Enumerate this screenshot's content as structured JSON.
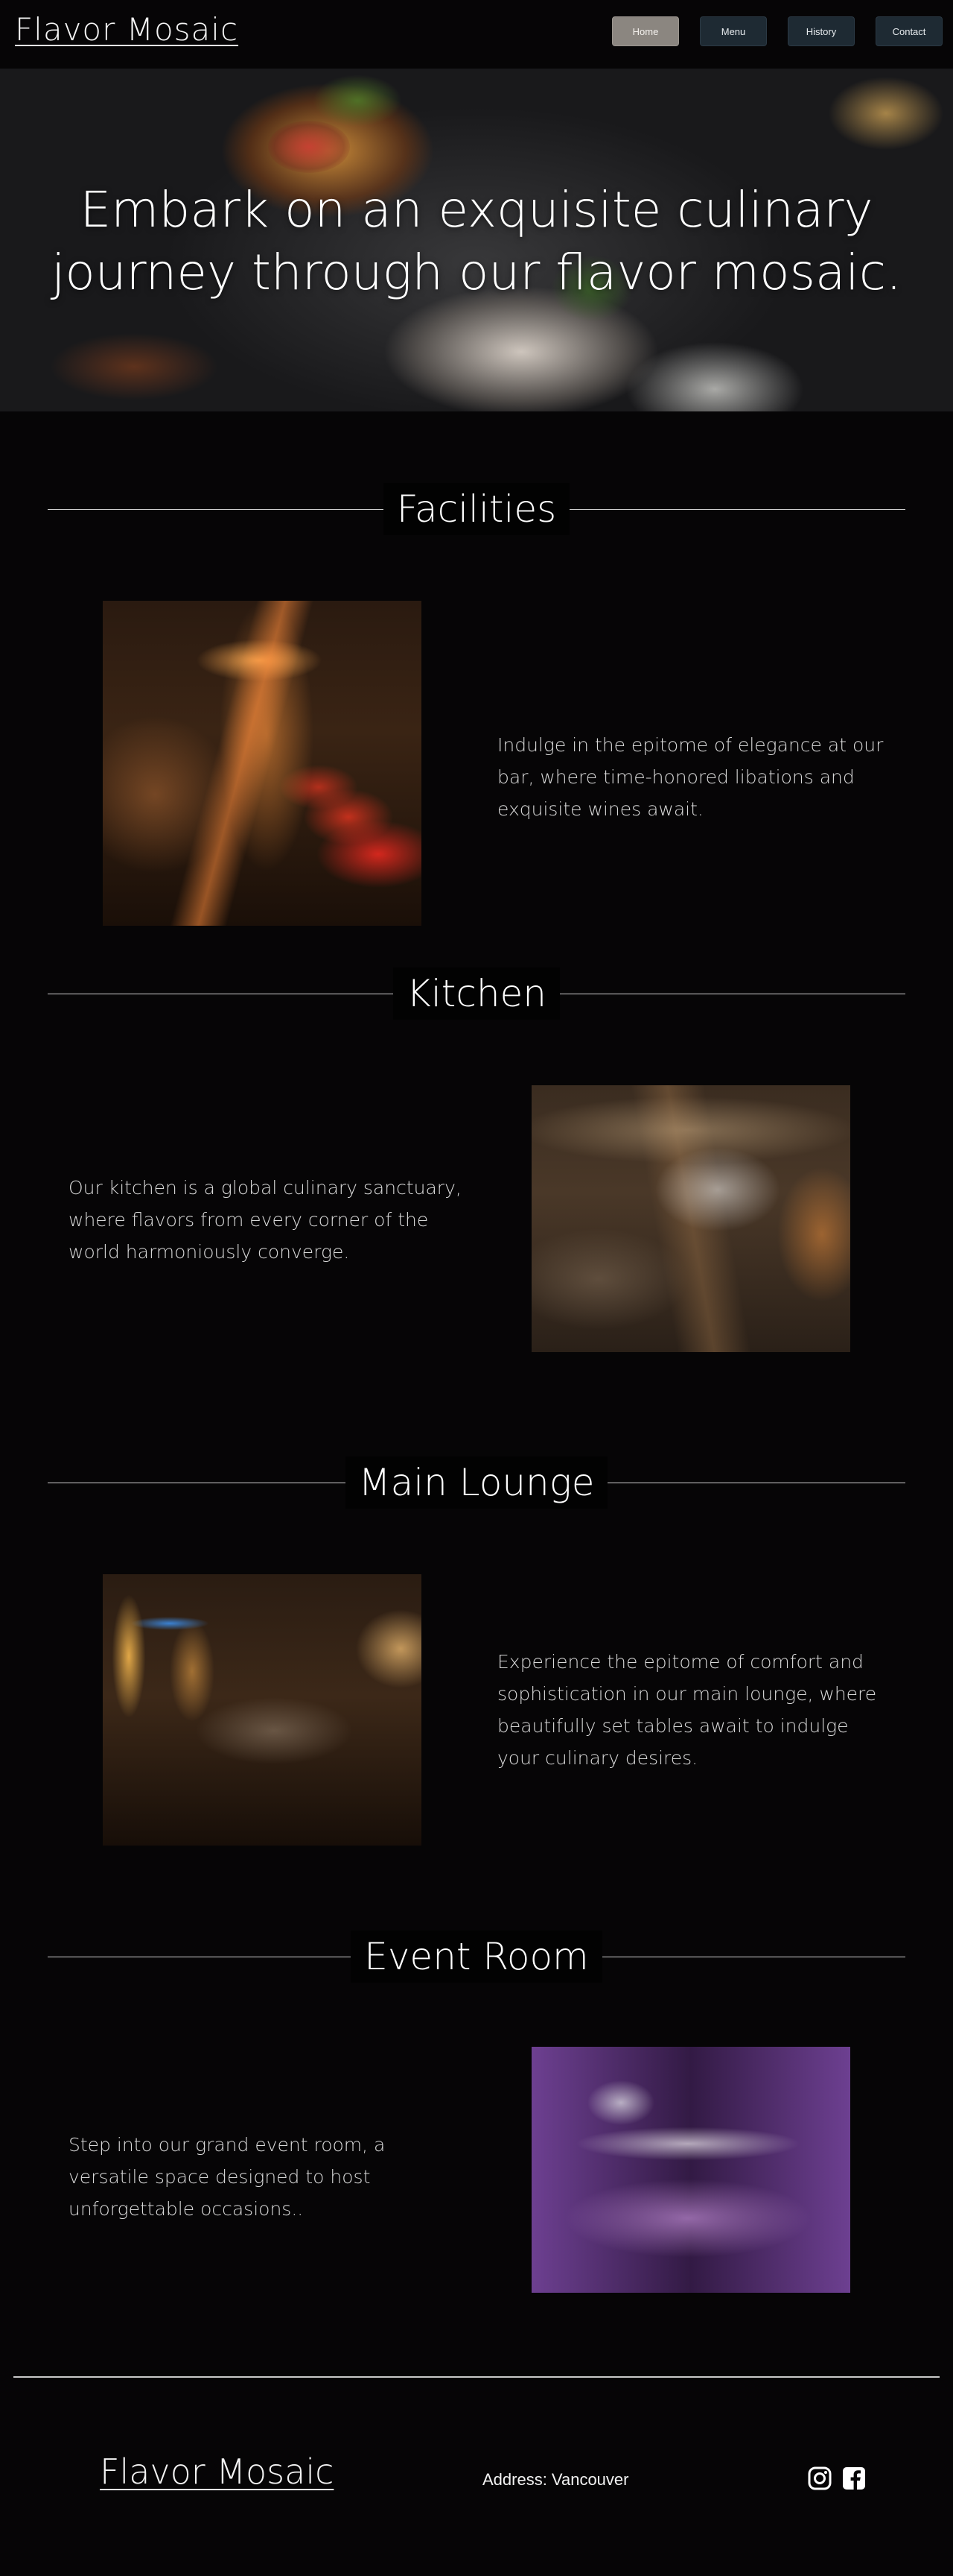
{
  "brand": "Flavor Mosaic",
  "nav": {
    "items": [
      {
        "label": "Home",
        "active": true
      },
      {
        "label": "Menu",
        "active": false
      },
      {
        "label": "History",
        "active": false
      },
      {
        "label": "Contact",
        "active": false
      }
    ]
  },
  "hero": {
    "title": "Embark on an exquisite culinary journey through our flavor mosaic."
  },
  "sections": {
    "facilities": {
      "heading": "Facilities",
      "description": "Indulge in the epitome of elegance at our bar, where time-honored libations and exquisite wines await."
    },
    "kitchen": {
      "heading": "Kitchen",
      "description": "Our kitchen is a global culinary sanctuary, where flavors from every corner of the world harmoniously converge."
    },
    "lounge": {
      "heading": "Main Lounge",
      "description": "Experience the epitome of comfort and sophistication in our main lounge, where beautifully set tables await to indulge your culinary desires."
    },
    "event": {
      "heading": "Event Room",
      "description": "Step into our grand event room, a versatile space designed to host unforgettable occasions.."
    }
  },
  "footer": {
    "brand": "Flavor Mosaic",
    "address": "Address: Vancouver",
    "social_icons": [
      "instagram-icon",
      "facebook-icon"
    ]
  },
  "colors": {
    "background": "#060506",
    "nav_button": "#1e2a33",
    "nav_button_active": "#8b8680",
    "text": "#f2f2f2"
  }
}
